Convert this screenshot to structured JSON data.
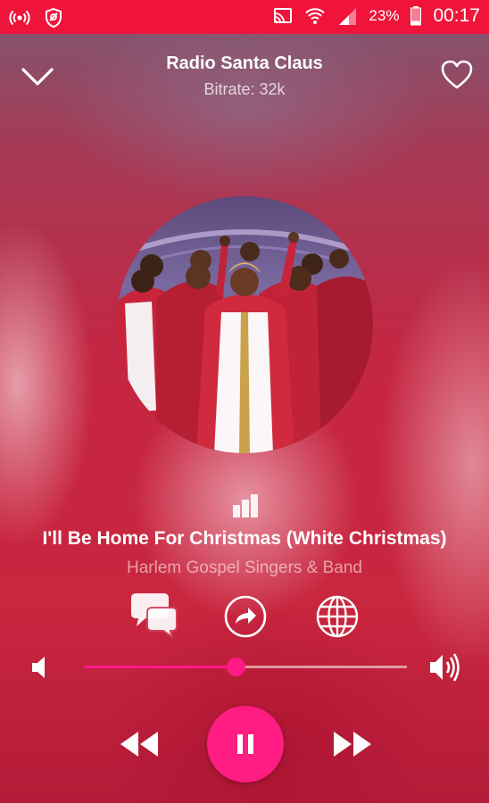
{
  "status_bar": {
    "battery": "23%",
    "time": "00:17",
    "icons": [
      "broadcast-icon",
      "shield-icon",
      "cast-icon",
      "wifi-icon",
      "signal-icon",
      "battery-icon"
    ]
  },
  "header": {
    "station_name": "Radio Santa Claus",
    "bitrate": "Bitrate: 32k",
    "icons": [
      "chevron-down-icon",
      "heart-icon"
    ]
  },
  "now_playing": {
    "title": "I'll Be Home For Christmas (White Christmas)",
    "artist": "Harlem Gospel Singers & Band",
    "album_art": "gospel-choir-in-red-robes"
  },
  "actions": [
    "chat-icon",
    "share-icon",
    "globe-icon"
  ],
  "volume": {
    "level": 0.47
  },
  "playback": {
    "state": "playing",
    "icons": [
      "rewind-icon",
      "pause-icon",
      "fast-forward-icon"
    ]
  },
  "colors": {
    "status_bar": "#f0143a",
    "accent": "#ff1c83"
  }
}
